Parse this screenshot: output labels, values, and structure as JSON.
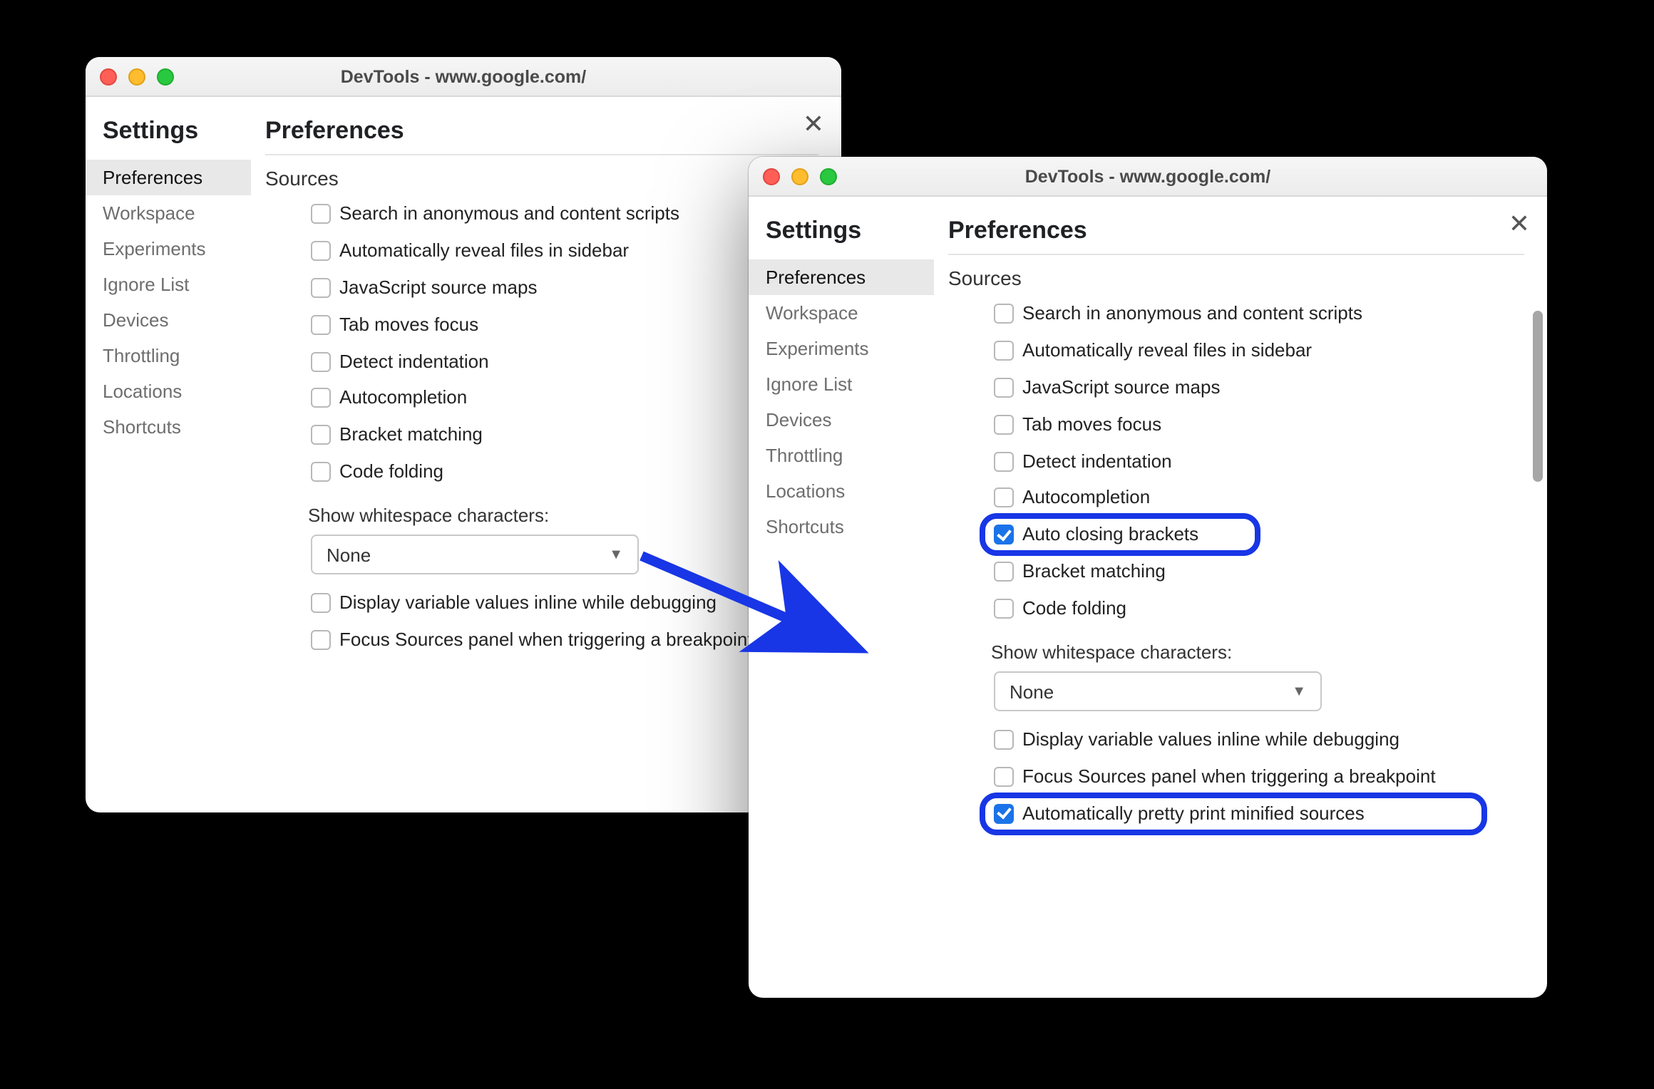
{
  "windows": {
    "left": {
      "title": "DevTools - www.google.com/",
      "sidebar_title": "Settings",
      "main_title": "Preferences",
      "section": "Sources",
      "sidebar": [
        {
          "label": "Preferences",
          "active": true
        },
        {
          "label": "Workspace",
          "active": false
        },
        {
          "label": "Experiments",
          "active": false
        },
        {
          "label": "Ignore List",
          "active": false
        },
        {
          "label": "Devices",
          "active": false
        },
        {
          "label": "Throttling",
          "active": false
        },
        {
          "label": "Locations",
          "active": false
        },
        {
          "label": "Shortcuts",
          "active": false
        }
      ],
      "options": [
        {
          "label": "Search in anonymous and content scripts",
          "checked": false
        },
        {
          "label": "Automatically reveal files in sidebar",
          "checked": false
        },
        {
          "label": "JavaScript source maps",
          "checked": false
        },
        {
          "label": "Tab moves focus",
          "checked": false
        },
        {
          "label": "Detect indentation",
          "checked": false
        },
        {
          "label": "Autocompletion",
          "checked": false
        },
        {
          "label": "Bracket matching",
          "checked": false
        },
        {
          "label": "Code folding",
          "checked": false
        }
      ],
      "whitespace_label": "Show whitespace characters:",
      "whitespace_value": "None",
      "opts_after": [
        {
          "label": "Display variable values inline while debugging",
          "checked": false
        },
        {
          "label": "Focus Sources panel when triggering a breakpoint",
          "checked": false
        }
      ]
    },
    "right": {
      "title": "DevTools - www.google.com/",
      "sidebar_title": "Settings",
      "main_title": "Preferences",
      "section": "Sources",
      "sidebar": [
        {
          "label": "Preferences",
          "active": true
        },
        {
          "label": "Workspace",
          "active": false
        },
        {
          "label": "Experiments",
          "active": false
        },
        {
          "label": "Ignore List",
          "active": false
        },
        {
          "label": "Devices",
          "active": false
        },
        {
          "label": "Throttling",
          "active": false
        },
        {
          "label": "Locations",
          "active": false
        },
        {
          "label": "Shortcuts",
          "active": false
        }
      ],
      "options": [
        {
          "label": "Search in anonymous and content scripts",
          "checked": false,
          "highlight": false
        },
        {
          "label": "Automatically reveal files in sidebar",
          "checked": false,
          "highlight": false
        },
        {
          "label": "JavaScript source maps",
          "checked": false,
          "highlight": false
        },
        {
          "label": "Tab moves focus",
          "checked": false,
          "highlight": false
        },
        {
          "label": "Detect indentation",
          "checked": false,
          "highlight": false
        },
        {
          "label": "Autocompletion",
          "checked": false,
          "highlight": false
        },
        {
          "label": "Auto closing brackets",
          "checked": true,
          "highlight": true
        },
        {
          "label": "Bracket matching",
          "checked": false,
          "highlight": false
        },
        {
          "label": "Code folding",
          "checked": false,
          "highlight": false
        }
      ],
      "whitespace_label": "Show whitespace characters:",
      "whitespace_value": "None",
      "opts_after": [
        {
          "label": "Display variable values inline while debugging",
          "checked": false,
          "highlight": false
        },
        {
          "label": "Focus Sources panel when triggering a breakpoint",
          "checked": false,
          "highlight": false
        },
        {
          "label": "Automatically pretty print minified sources",
          "checked": true,
          "highlight": true
        }
      ]
    }
  },
  "colors": {
    "accent": "#1836e6",
    "checkbox": "#1a73e8"
  }
}
